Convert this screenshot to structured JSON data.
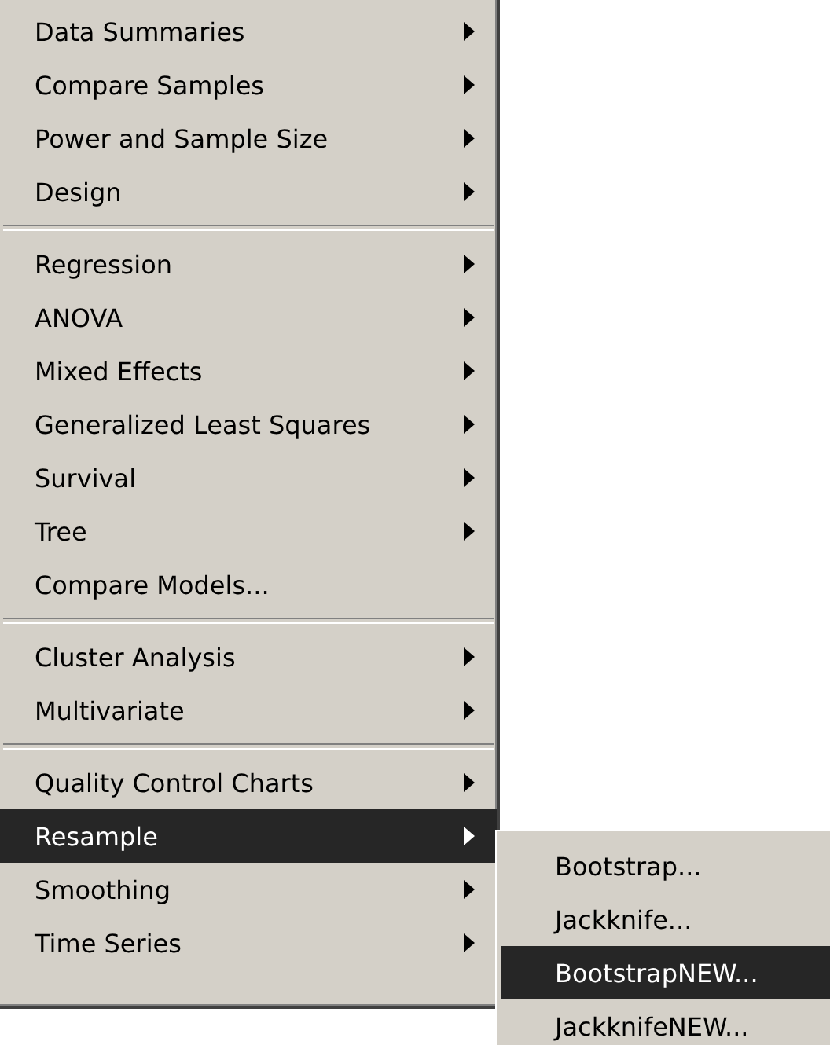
{
  "menu": {
    "groups": [
      {
        "items": [
          {
            "label": "Data Summaries",
            "has_submenu": true,
            "selected": false
          },
          {
            "label": "Compare Samples",
            "has_submenu": true,
            "selected": false
          },
          {
            "label": "Power and Sample Size",
            "has_submenu": true,
            "selected": false
          },
          {
            "label": "Design",
            "has_submenu": true,
            "selected": false
          }
        ]
      },
      {
        "items": [
          {
            "label": "Regression",
            "has_submenu": true,
            "selected": false
          },
          {
            "label": "ANOVA",
            "has_submenu": true,
            "selected": false
          },
          {
            "label": "Mixed Effects",
            "has_submenu": true,
            "selected": false
          },
          {
            "label": "Generalized Least Squares",
            "has_submenu": true,
            "selected": false
          },
          {
            "label": "Survival",
            "has_submenu": true,
            "selected": false
          },
          {
            "label": "Tree",
            "has_submenu": true,
            "selected": false
          },
          {
            "label": "Compare Models...",
            "has_submenu": false,
            "selected": false
          }
        ]
      },
      {
        "items": [
          {
            "label": "Cluster Analysis",
            "has_submenu": true,
            "selected": false
          },
          {
            "label": "Multivariate",
            "has_submenu": true,
            "selected": false
          }
        ]
      },
      {
        "items": [
          {
            "label": "Quality Control Charts",
            "has_submenu": true,
            "selected": false
          },
          {
            "label": "Resample",
            "has_submenu": true,
            "selected": true
          },
          {
            "label": "Smoothing",
            "has_submenu": true,
            "selected": false
          },
          {
            "label": "Time Series",
            "has_submenu": true,
            "selected": false
          }
        ]
      }
    ]
  },
  "submenu": {
    "items": [
      {
        "label": "Bootstrap...",
        "selected": false
      },
      {
        "label": "Jackknife...",
        "selected": false
      },
      {
        "label": "BootstrapNEW...",
        "selected": true
      },
      {
        "label": "JackknifeNEW...",
        "selected": false
      }
    ]
  }
}
